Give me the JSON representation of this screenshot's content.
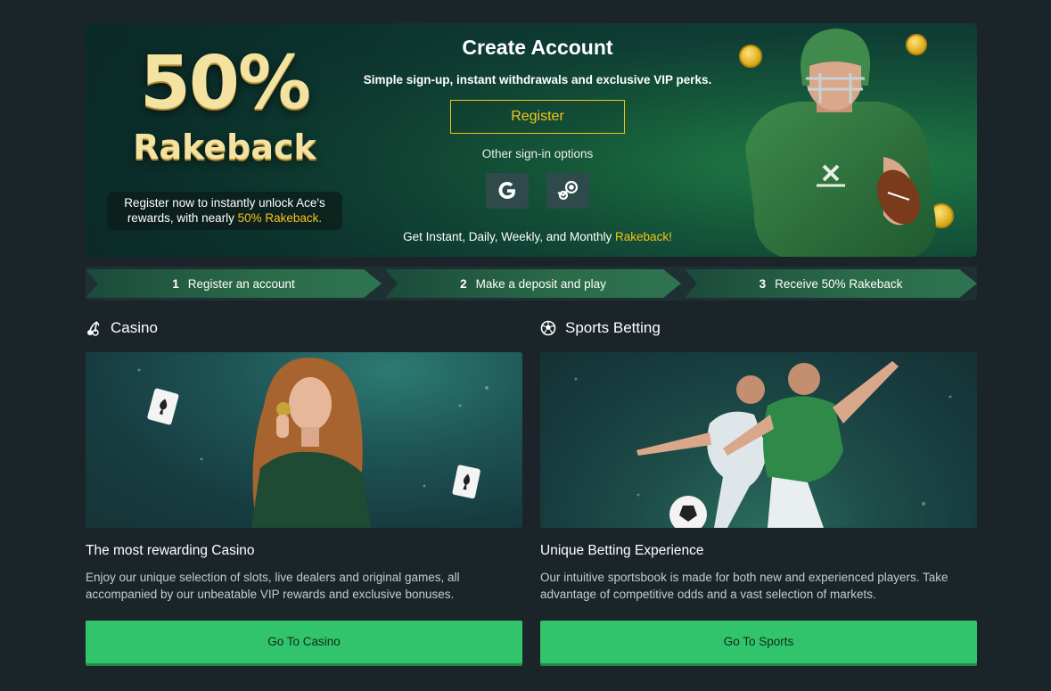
{
  "hero": {
    "promo_percent": "50%",
    "promo_word": "Rakeback",
    "promo_note_1": "Register now to instantly unlock Ace's",
    "promo_note_2": "rewards, with nearly ",
    "promo_note_highlight": "50% Rakeback.",
    "title": "Create Account",
    "subtitle": "Simple sign-up, instant withdrawals and exclusive VIP perks.",
    "register_label": "Register",
    "other_signin_label": "Other sign-in options",
    "social": [
      {
        "name": "google",
        "icon": "google-icon"
      },
      {
        "name": "steam",
        "icon": "steam-icon"
      }
    ],
    "footer_text": "Get Instant, Daily, Weekly, and Monthly ",
    "footer_highlight": "Rakeback!"
  },
  "steps": [
    {
      "number": "1",
      "label": "Register an account"
    },
    {
      "number": "2",
      "label": "Make a deposit and play"
    },
    {
      "number": "3",
      "label": "Receive 50% Rakeback"
    }
  ],
  "casino": {
    "section_title": "Casino",
    "icon": "cherry-icon",
    "heading": "The most rewarding Casino",
    "text": "Enjoy our unique selection of slots, live dealers and original games, all accompanied by our unbeatable VIP rewards and exclusive bonuses.",
    "button_label": "Go To Casino"
  },
  "sports": {
    "section_title": "Sports Betting",
    "icon": "soccer-ball-icon",
    "heading": "Unique Betting Experience",
    "text": "Our intuitive sportsbook is made for both new and experienced players. Take advantage of competitive odds and a vast selection of markets.",
    "button_label": "Go To Sports"
  },
  "colors": {
    "background": "#1b2529",
    "accent_gold": "#f5c518",
    "cta_green": "#32c46c"
  }
}
